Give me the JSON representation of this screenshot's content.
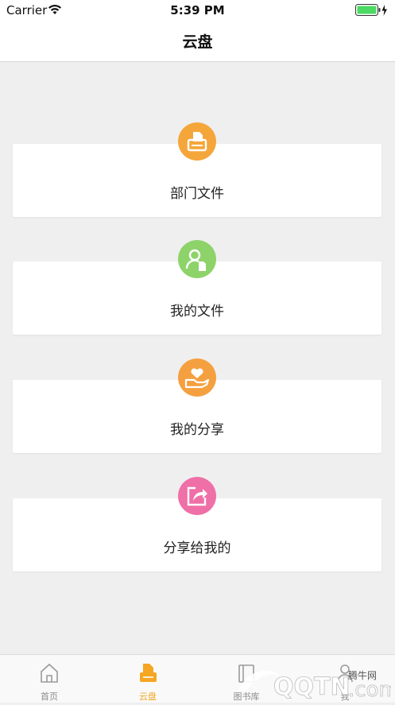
{
  "status_bar": {
    "carrier": "Carrier",
    "time": "5:39 PM"
  },
  "nav": {
    "title": "云盘"
  },
  "cards": [
    {
      "label": "部门文件",
      "icon": "department-file-icon",
      "color": "#f5a63b"
    },
    {
      "label": "我的文件",
      "icon": "my-file-icon",
      "color": "#8dd36a"
    },
    {
      "label": "我的分享",
      "icon": "my-share-icon",
      "color": "#f5a040"
    },
    {
      "label": "分享给我的",
      "icon": "shared-with-me-icon",
      "color": "#ef6fa7"
    }
  ],
  "tabs": [
    {
      "label": "首页",
      "icon": "home-icon",
      "active": false
    },
    {
      "label": "云盘",
      "icon": "cloud-drive-icon",
      "active": true
    },
    {
      "label": "图书库",
      "icon": "library-icon",
      "active": false
    },
    {
      "label": "我",
      "icon": "profile-icon",
      "active": false
    }
  ],
  "colors": {
    "accent": "#f5a623",
    "background": "#efefef"
  }
}
